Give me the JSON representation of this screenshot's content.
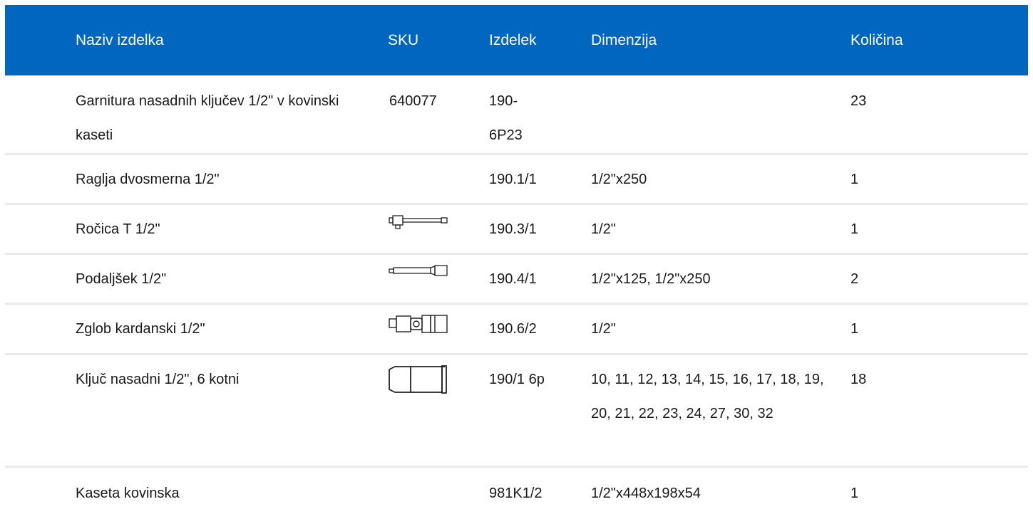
{
  "header": {
    "name": "Naziv izdelka",
    "sku": "SKU",
    "izdelek": "Izdelek",
    "dimenzija": "Dimenzija",
    "kolicina": "Količina"
  },
  "rows": [
    {
      "name": "Garnitura nasadnih ključev 1/2\" v kovinski kaseti",
      "sku": "640077",
      "izdelek": "190-\n6P23",
      "dimenzija": "",
      "kolicina": "23",
      "icon": ""
    },
    {
      "name": "Raglja dvosmerna 1/2\"",
      "sku": "",
      "izdelek": "190.1/1",
      "dimenzija": "1/2\"x250",
      "kolicina": "1",
      "icon": ""
    },
    {
      "name": "Ročica T 1/2\"",
      "sku": "",
      "izdelek": "190.3/1",
      "dimenzija": "1/2\"",
      "kolicina": "1",
      "icon": "t-handle-icon"
    },
    {
      "name": "Podaljšek 1/2\"",
      "sku": "",
      "izdelek": "190.4/1",
      "dimenzija": "1/2\"x125, 1/2\"x250",
      "kolicina": "2",
      "icon": "extension-bar-icon"
    },
    {
      "name": "Zglob kardanski 1/2\"",
      "sku": "",
      "izdelek": "190.6/2",
      "dimenzija": "1/2\"",
      "kolicina": "1",
      "icon": "universal-joint-icon"
    },
    {
      "name": "Ključ nasadni 1/2\", 6 kotni",
      "sku": "",
      "izdelek": "190/1 6p",
      "dimenzija": "10, 11, 12, 13, 14, 15, 16, 17, 18, 19, 20, 21, 22, 23, 24, 27, 30, 32",
      "kolicina": "18",
      "icon": "socket-icon"
    },
    {
      "name": "Kaseta kovinska",
      "sku": "",
      "izdelek": "981K1/2",
      "dimenzija": "1/2\"x448x198x54",
      "kolicina": "1",
      "icon": ""
    }
  ],
  "colors": {
    "header_bg": "#0066bf",
    "header_text": "#ffffff",
    "divider": "#e8eaec"
  }
}
